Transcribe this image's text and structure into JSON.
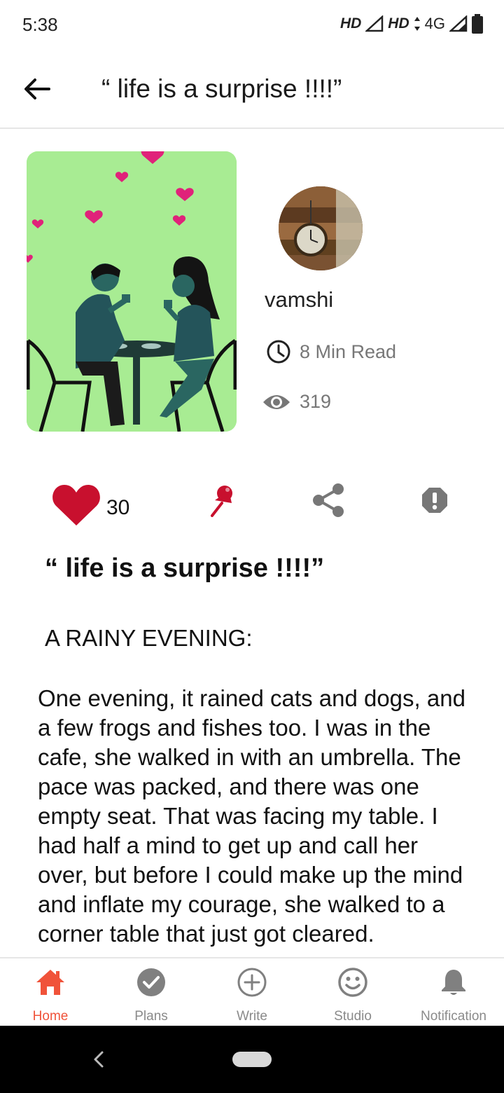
{
  "status_bar": {
    "time": "5:38",
    "network_1": "HD",
    "network_2": "HD",
    "network_3": "4G"
  },
  "app_bar": {
    "title": "“ life is a surprise !!!!”",
    "back_icon": "arrow-left-icon"
  },
  "story": {
    "author": "vamshi",
    "read_time": "8 Min Read",
    "views": "319",
    "likes": "30",
    "title": "“ life is a surprise !!!!”",
    "subheading": "A RAINY EVENING:",
    "body": "One evening, it rained cats and dogs, and a few frogs and fishes too. I was in the cafe, she walked in with an umbrella. The pace was packed, and there was one empty seat. That was facing my table. I had half a mind to get up and call her over, but before I could make up the mind and inflate my courage, she walked to a corner table that just got cleared."
  },
  "colors": {
    "accent": "#f0533a",
    "like": "#c8102e",
    "cover_bg": "#a8ec93"
  },
  "bottom_nav": {
    "items": [
      {
        "label": "Home",
        "icon": "home-icon",
        "active": true
      },
      {
        "label": "Plans",
        "icon": "check-circle-icon",
        "active": false
      },
      {
        "label": "Write",
        "icon": "plus-circle-icon",
        "active": false
      },
      {
        "label": "Studio",
        "icon": "smiley-icon",
        "active": false
      },
      {
        "label": "Notification",
        "icon": "bell-icon",
        "active": false
      }
    ]
  }
}
